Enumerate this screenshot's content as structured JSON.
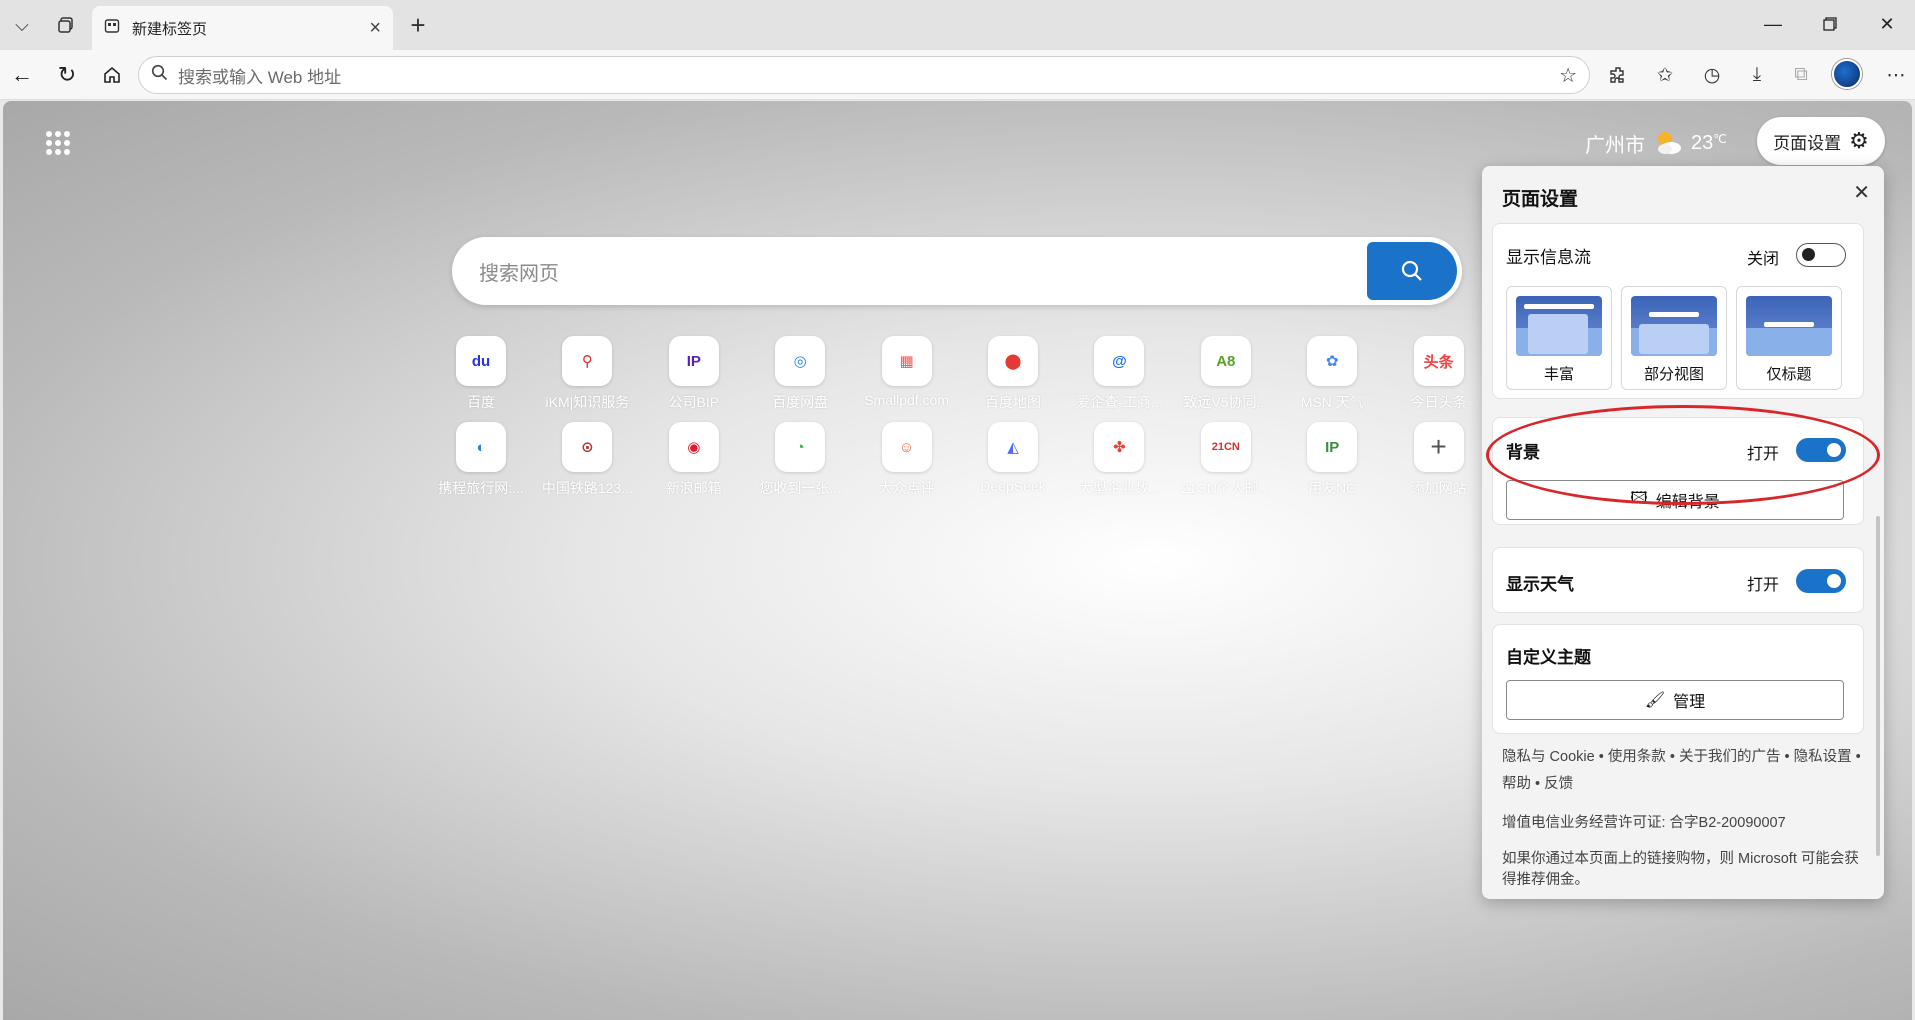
{
  "browser": {
    "tab_title": "新建标签页",
    "address_placeholder": "搜索或输入 Web 地址"
  },
  "page": {
    "weather": {
      "city": "广州市",
      "temp": "23",
      "unit": "℃"
    },
    "page_settings_label": "页面设置",
    "search_placeholder": "搜索网页",
    "shortcuts": [
      {
        "label": "百度",
        "glyph": "du",
        "color": "#2932e1"
      },
      {
        "label": "iKM|知识服务",
        "glyph": "⚲",
        "color": "#e02c2c"
      },
      {
        "label": "公司BIP",
        "glyph": "IP",
        "color": "#5a1fb3"
      },
      {
        "label": "百度网盘",
        "glyph": "◎",
        "color": "#1e88e5"
      },
      {
        "label": "Smallpdf.com",
        "glyph": "▦",
        "color": "#ff4d4d"
      },
      {
        "label": "百度地图",
        "glyph": "⬤",
        "color": "#e53935"
      },
      {
        "label": "爱企查-工商...",
        "glyph": "@",
        "color": "#1a73e8"
      },
      {
        "label": "致远V5协同...",
        "glyph": "A8",
        "color": "#5aa02c"
      },
      {
        "label": "MSN 天气",
        "glyph": "✿",
        "color": "#4285f4"
      },
      {
        "label": "今日头条",
        "glyph": "头条",
        "color": "#f04142"
      },
      {
        "label": "携程旅行网:...",
        "glyph": "◐",
        "color": "#2a7de1"
      },
      {
        "label": "中国铁路123...",
        "glyph": "⊙",
        "color": "#b83232"
      },
      {
        "label": "新浪邮箱",
        "glyph": "◉",
        "color": "#e6162d"
      },
      {
        "label": "您收到一张...",
        "glyph": "◔",
        "color": "#34a853"
      },
      {
        "label": "大众点评",
        "glyph": "☺",
        "color": "#ff6633"
      },
      {
        "label": "DeepSeek",
        "glyph": "◭",
        "color": "#4d6bfe"
      },
      {
        "label": "大型企业数...",
        "glyph": "✤",
        "color": "#ea4335"
      },
      {
        "label": "21CN个人邮...",
        "glyph": "21CN",
        "color": "#d32f2f"
      },
      {
        "label": "用友NC",
        "glyph": "IP",
        "color": "#3e8e41"
      },
      {
        "label": "添加网站",
        "glyph": "+",
        "color": "#555555"
      }
    ]
  },
  "settings": {
    "title": "页面设置",
    "feed": {
      "label": "显示信息流",
      "state": "关闭",
      "options": [
        "丰富",
        "部分视图",
        "仅标题"
      ]
    },
    "background": {
      "label": "背景",
      "state": "打开",
      "edit_label": "编辑背景"
    },
    "weather": {
      "label": "显示天气",
      "state": "打开"
    },
    "theme": {
      "label": "自定义主题",
      "manage_label": "管理"
    },
    "links": [
      "隐私与 Cookie",
      "使用条款",
      "关于我们的广告",
      "隐私设置",
      "帮助",
      "反馈"
    ],
    "license": "增值电信业务经营许可证: 合字B2-20090007",
    "disclaimer": "如果你通过本页面上的链接购物，则 Microsoft 可能会获得推荐佣金。"
  }
}
